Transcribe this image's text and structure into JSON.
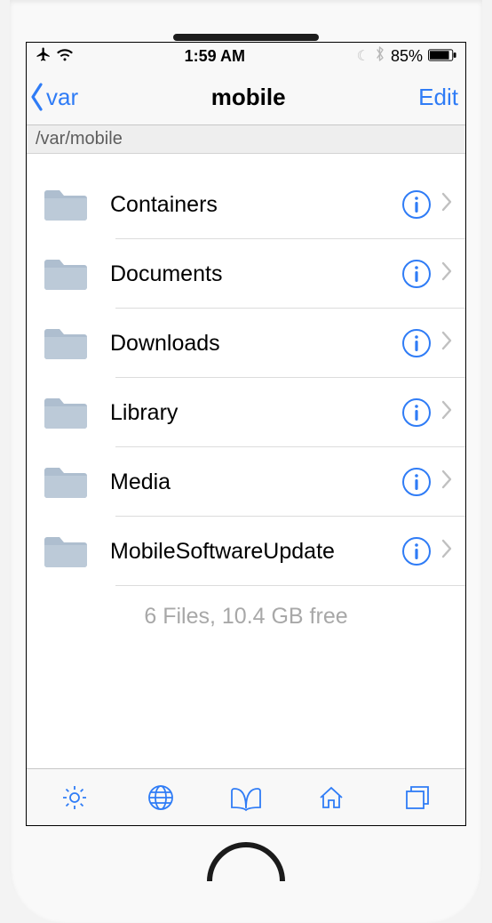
{
  "status": {
    "time": "1:59 AM",
    "battery_pct": "85%"
  },
  "nav": {
    "back_label": "var",
    "title": "mobile",
    "edit_label": "Edit"
  },
  "path": "/var/mobile",
  "files": [
    {
      "name": "Containers"
    },
    {
      "name": "Documents"
    },
    {
      "name": "Downloads"
    },
    {
      "name": "Library"
    },
    {
      "name": "Media"
    },
    {
      "name": "MobileSoftwareUpdate"
    }
  ],
  "summary": "6 Files, 10.4 GB free"
}
